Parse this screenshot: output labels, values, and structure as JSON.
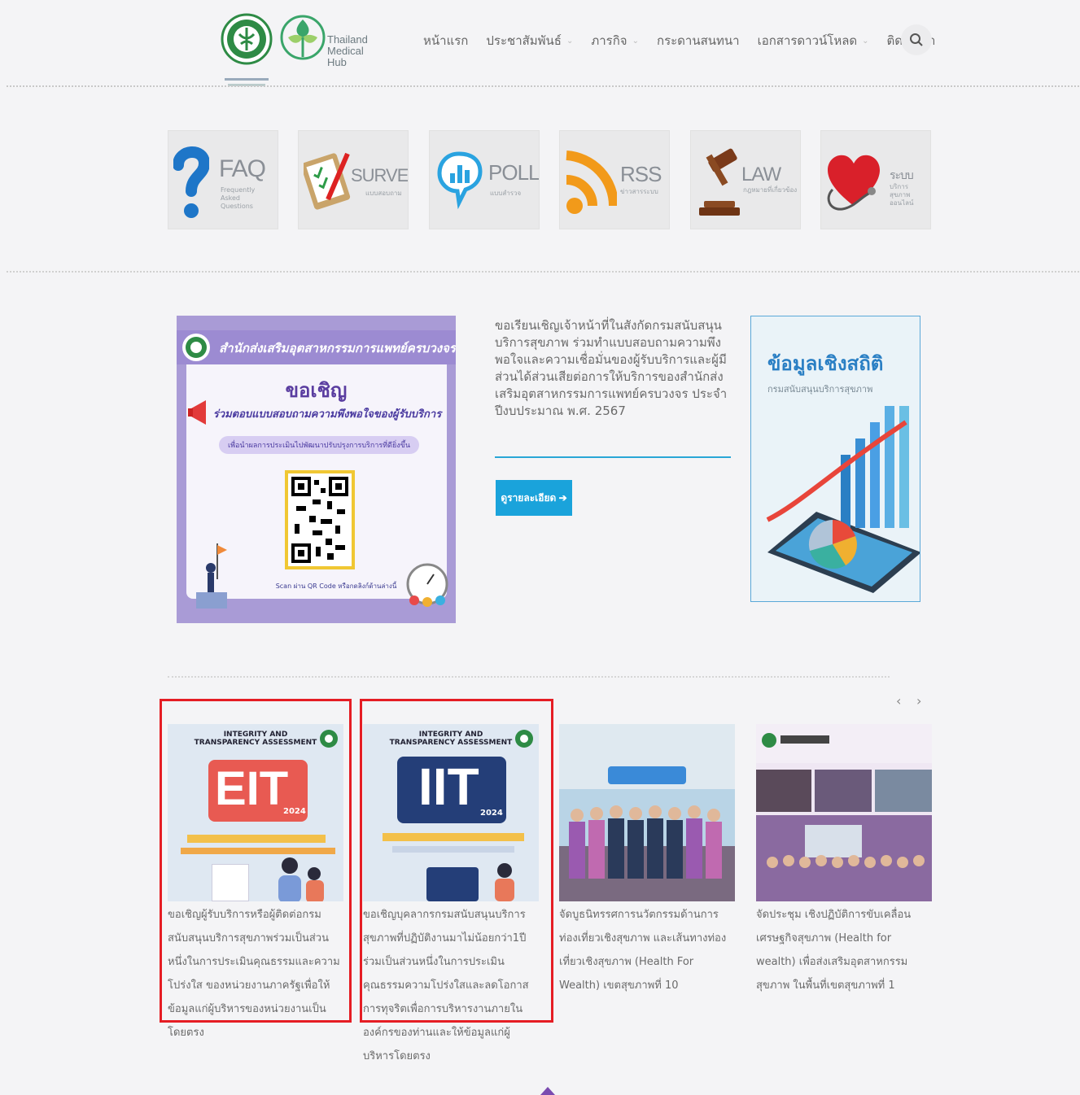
{
  "header": {
    "tmh_logo_line1": "Thailand",
    "tmh_logo_line2": "Medical Hub",
    "nav": [
      {
        "label": "หน้าแรก",
        "dropdown": false
      },
      {
        "label": "ประชาสัมพันธ์",
        "dropdown": true
      },
      {
        "label": "ภารกิจ",
        "dropdown": true
      },
      {
        "label": "กระดานสนทนา",
        "dropdown": false
      },
      {
        "label": "เอกสารดาวน์โหลด",
        "dropdown": true
      },
      {
        "label": "ติดต่อเรา",
        "dropdown": false
      }
    ]
  },
  "tiles": [
    {
      "title": "FAQ",
      "subtitle": "Frequently Asked Questions",
      "icon": "question-mark-icon"
    },
    {
      "title": "SURVEY",
      "subtitle": "แบบสอบถาม",
      "icon": "clipboard-survey-icon"
    },
    {
      "title": "POLL",
      "subtitle": "แบบสำรวจ",
      "icon": "poll-chat-icon"
    },
    {
      "title": "RSS",
      "subtitle": "ข่าวสารระบบ",
      "icon": "rss-feed-icon"
    },
    {
      "title": "LAW",
      "subtitle": "กฎหมายที่เกี่ยวข้อง",
      "icon": "gavel-icon"
    },
    {
      "title": "ระบบ",
      "subtitle": "บริการสุขภาพ ออนไลน์",
      "icon": "heart-stethoscope-icon"
    }
  ],
  "poster": {
    "header": "สำนักส่งเสริมอุตสาหกรรมการแพทย์ครบวงจร",
    "invite": "ขอเชิญ",
    "subtitle": "ร่วมตอบแบบสอบถามความพึงพอใจของผู้รับบริการ",
    "pill": "เพื่อนำผลการประเมินไปพัฒนาปรับปรุงการบริการที่ดียิ่งขึ้น",
    "footer": "Scan ผ่าน QR Code หรือกดลิงก์ด้านล่างนี้"
  },
  "survey": {
    "text": "ขอเรียนเชิญเจ้าหน้าที่ในสังกัดกรมสนับสนุนบริการสุขภาพ ร่วมทำแบบสอบถามความพึงพอใจและความเชื่อมั่นของผู้รับบริการและผู้มีส่วนได้ส่วนเสียต่อการให้บริการของสำนักส่งเสริมอุตสาหกรรมการแพทย์ครบวงจร ประจำปีงบประมาณ พ.ศ. 2567",
    "button": "ดูรายละเอียด ➔"
  },
  "stats": {
    "title": "ข้อมูลเชิงสถิติ",
    "subtitle": "กรมสนับสนุนบริการสุขภาพ"
  },
  "carousel": {
    "prev": "‹",
    "next": "›"
  },
  "news": [
    {
      "badge": "EIT",
      "year": "2024",
      "header": "INTEGRITY AND TRANSPARENCY ASSESSMENT",
      "caption": "ขอเชิญผู้รับบริการหรือผู้ติดต่อกรมสนับสนุนบริการสุขภาพร่วมเป็นส่วนหนึ่งในการประเมินคุณธรรมและความโปร่งใส ของหน่วยงานภาครัฐเพื่อให้ข้อมูลแก่ผู้บริหารของหน่วยงานเป็นโดยตรง"
    },
    {
      "badge": "IIT",
      "year": "2024",
      "header": "INTEGRITY AND TRANSPARENCY ASSESSMENT",
      "caption": "ขอเชิญบุคลากรกรมสนับสนุนบริการสุขภาพที่ปฏิบัติงานมาไม่น้อยกว่า1ปี ร่วมเป็นส่วนหนึ่งในการประเมินคุณธรรมความโปร่งใสและลดโอกาสการทุจริตเพื่อการบริหารงานภายในองค์กรของท่านและให้ข้อมูลแก่ผู้บริหารโดยตรง"
    },
    {
      "caption": "จัดบูธนิทรรศการนวัตกรรมด้านการท่องเที่ยวเชิงสุขภาพ และเส้นทางท่องเที่ยวเชิงสุขภาพ (Health For Wealth) เขตสุขภาพที่ 10"
    },
    {
      "caption": "จัดประชุม เชิงปฏิบัติการขับเคลื่อนเศรษฐกิจสุขภาพ (Health for wealth) เพื่อส่งเสริมอุตสาหกรรมสุขภาพ ในพื้นที่เขตสุขภาพที่ 1"
    }
  ]
}
